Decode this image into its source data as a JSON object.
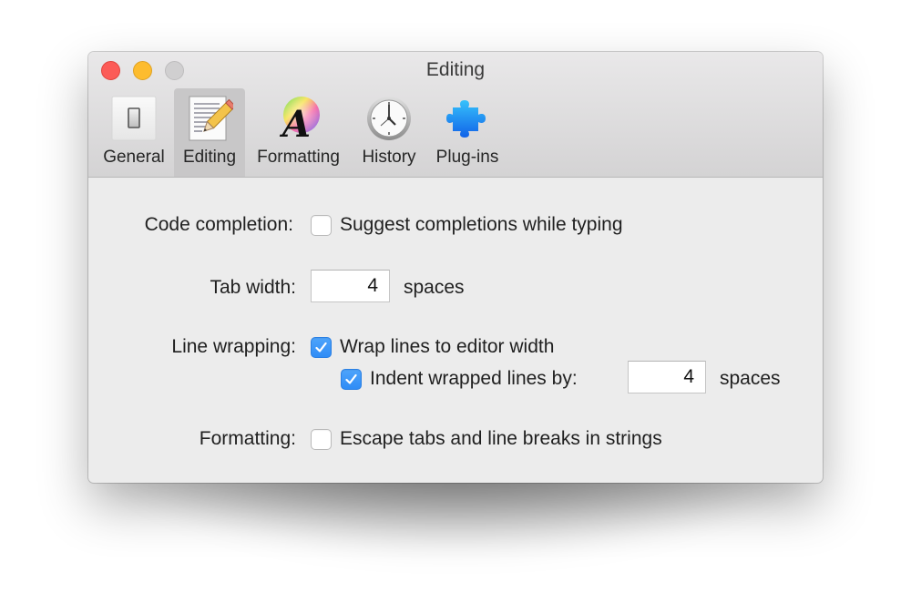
{
  "window": {
    "title": "Editing",
    "controls": [
      "close",
      "minimize",
      "zoom"
    ]
  },
  "toolbar": {
    "tabs": [
      {
        "label": "General",
        "icon": "switch-icon",
        "selected": false
      },
      {
        "label": "Editing",
        "icon": "pencil-document-icon",
        "selected": true
      },
      {
        "label": "Formatting",
        "icon": "color-font-icon",
        "selected": false
      },
      {
        "label": "History",
        "icon": "clock-icon",
        "selected": false
      },
      {
        "label": "Plug-ins",
        "icon": "puzzle-piece-icon",
        "selected": false
      }
    ]
  },
  "settings": {
    "code_completion": {
      "label": "Code completion:",
      "checkbox_label": "Suggest completions while typing",
      "checked": false
    },
    "tab_width": {
      "label": "Tab width:",
      "value": "4",
      "unit": "spaces"
    },
    "line_wrapping": {
      "label": "Line wrapping:",
      "wrap_label": "Wrap lines to editor width",
      "wrap_checked": true,
      "indent_label": "Indent wrapped lines by:",
      "indent_checked": true,
      "indent_value": "4",
      "indent_unit": "spaces"
    },
    "formatting": {
      "label": "Formatting:",
      "checkbox_label": "Escape tabs and line breaks in strings",
      "checked": false
    }
  },
  "colors": {
    "accent": "#3a93f7",
    "close": "#fc5b57",
    "minimize": "#fdbc2e",
    "zoom_inactive": "#d0cfd0"
  }
}
